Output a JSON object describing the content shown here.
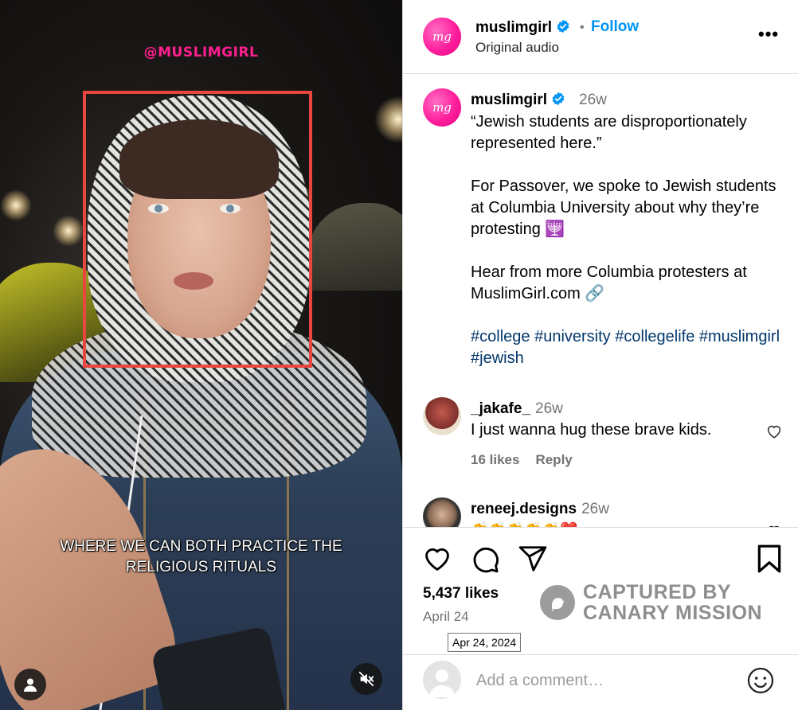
{
  "media": {
    "watermark": "@MUSLIMGIRL",
    "subtitle": "WHERE WE CAN BOTH PRACTICE THE\nRELIGIOUS RITUALS"
  },
  "header": {
    "username": "muslimgirl",
    "follow_label": "Follow",
    "audio": "Original audio",
    "more_label": "•••",
    "avatar_text": "mg"
  },
  "caption": {
    "username": "muslimgirl",
    "time": "26w",
    "quote": "“Jewish students are disproportionately represented here.”",
    "body": "For Passover, we spoke to Jewish students at Columbia University about why they’re protesting 🕎",
    "more": "Hear from more Columbia protesters at MuslimGirl.com 🔗",
    "hashtags": [
      "#college",
      "#university",
      "#collegelife",
      "#muslimgirl",
      "#jewish"
    ]
  },
  "comments": [
    {
      "username": "_jakafe_",
      "time": "26w",
      "text": "I just wanna hug these brave kids.",
      "likes": "16 likes",
      "reply": "Reply"
    },
    {
      "username": "reneej.designs",
      "time": "26w",
      "text": "👏👏👏👏👏❤️"
    }
  ],
  "post": {
    "likes": "5,437 likes",
    "date": "April 24",
    "tooltip": "Apr 24, 2024"
  },
  "overlay": {
    "line1": "CAPTURED BY",
    "line2": "CANARY MISSION"
  },
  "add_comment": {
    "placeholder": "Add a comment…"
  },
  "colors": {
    "accent": "#0095f6",
    "brand_pink": "#ff1f9d",
    "hashtag": "#00376b",
    "highlight_box": "#e8463f"
  },
  "icons": [
    "verified-badge-icon",
    "more-options-icon",
    "heart-icon",
    "comment-icon",
    "share-icon",
    "bookmark-icon",
    "emoji-icon",
    "user-tag-icon",
    "muted-speaker-icon",
    "canary-bird-icon"
  ]
}
